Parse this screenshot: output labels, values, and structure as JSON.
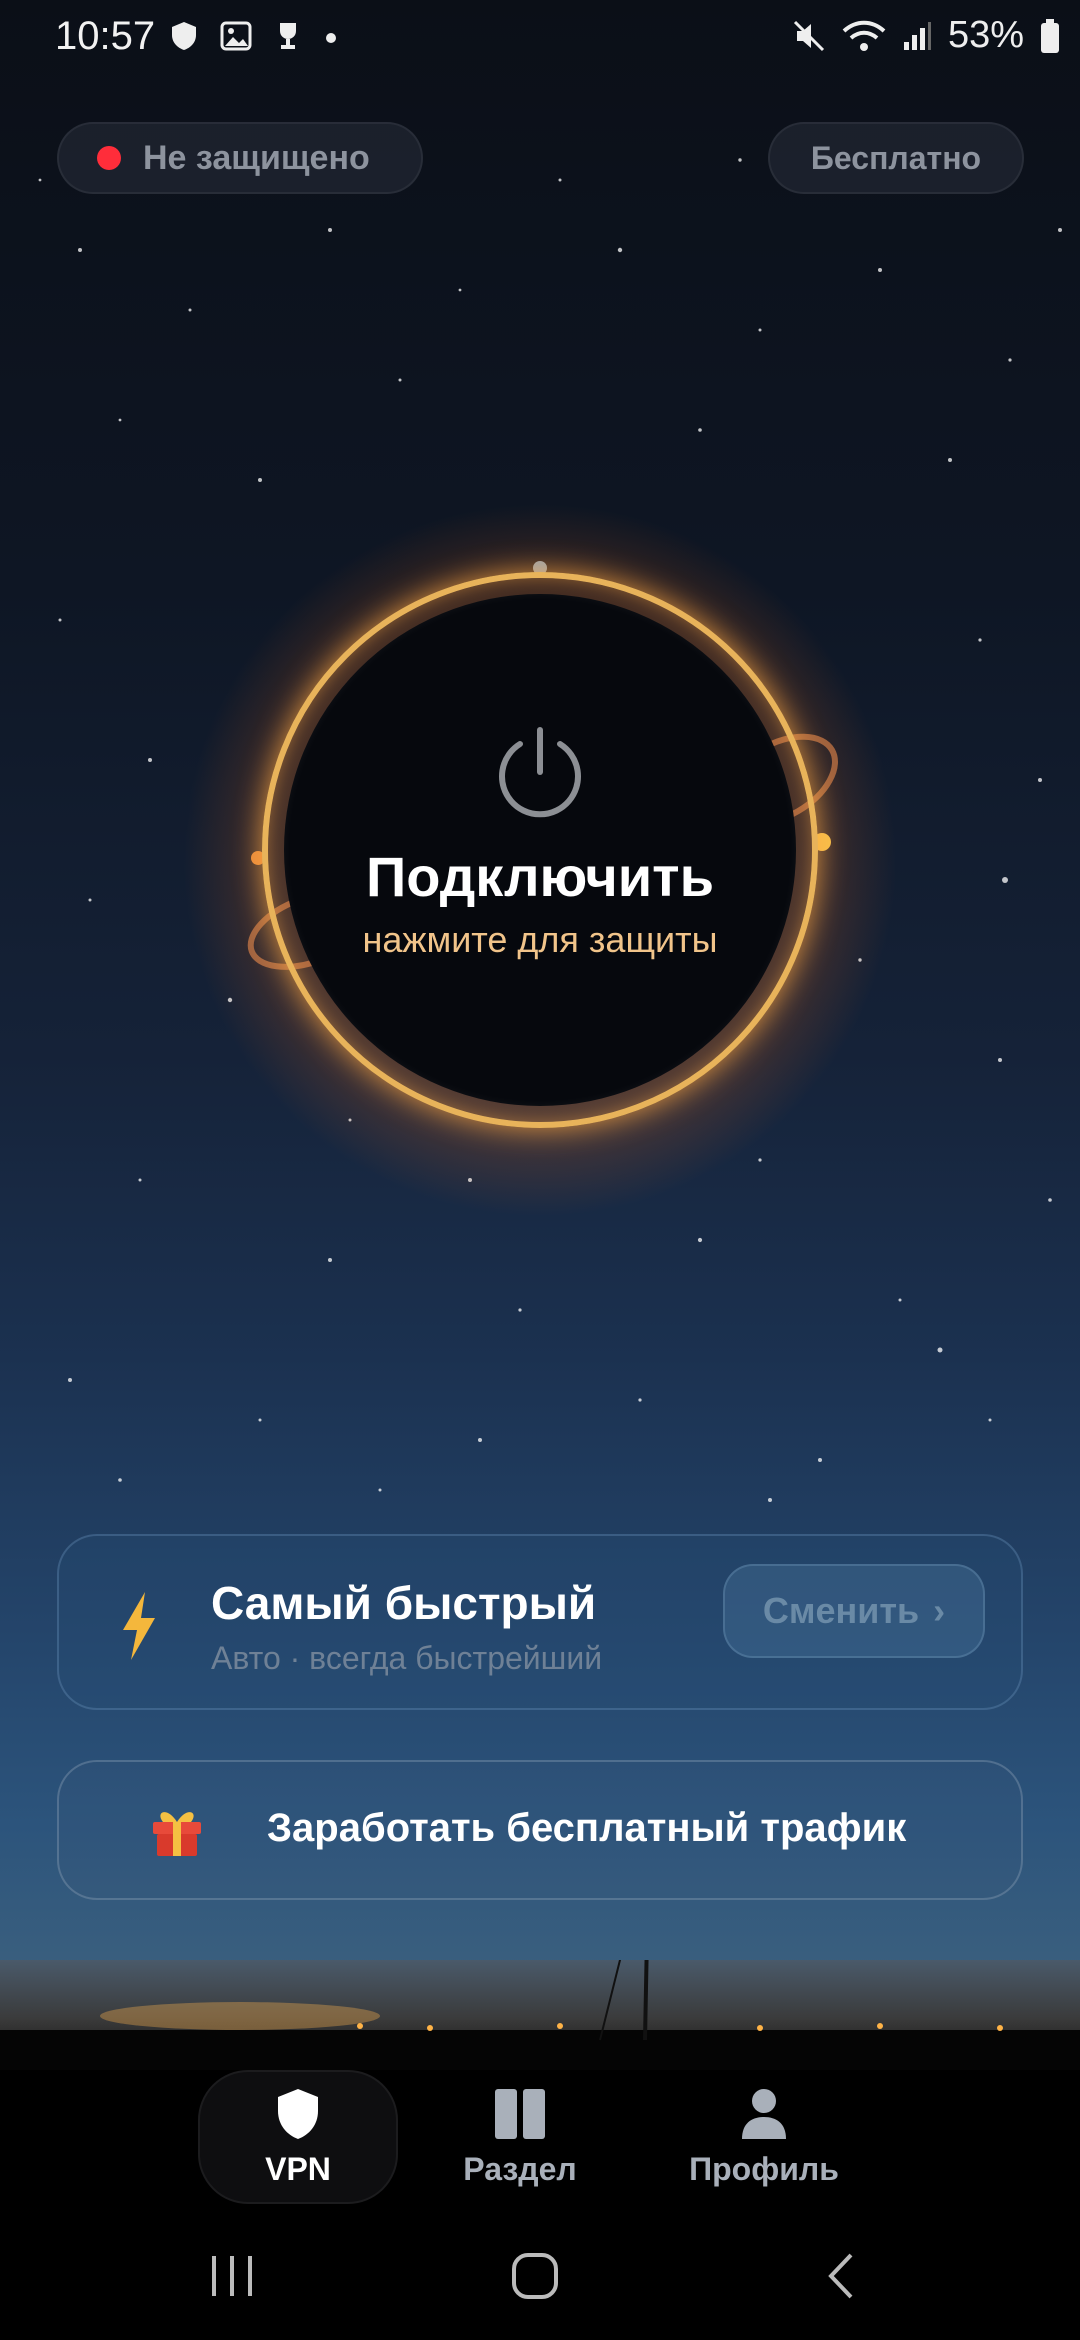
{
  "status_bar": {
    "time": "10:57",
    "battery": "53%",
    "left_icons": [
      "shield-icon",
      "image-icon",
      "trophy-icon",
      "dot-icon"
    ],
    "right_icons": [
      "mute-icon",
      "wifi-icon",
      "signal-icon",
      "battery-icon"
    ]
  },
  "header": {
    "connection_status": "Не защищено",
    "status_color": "#ff2d3a",
    "plan": "Бесплатно"
  },
  "connect": {
    "title": "Подключить",
    "subtitle": "нажмите для защиты",
    "accent": "#e8b35a"
  },
  "server": {
    "title": "Самый быстрый",
    "subtitle": "Авто · всегда быстрейший",
    "change_label": "Сменить",
    "change_chevron": "›"
  },
  "earn": {
    "label": "Заработать бесплатный трафик"
  },
  "tabs": [
    {
      "label": "VPN",
      "icon": "shield-icon",
      "active": true
    },
    {
      "label": "Раздел",
      "icon": "split-icon",
      "active": false
    },
    {
      "label": "Профиль",
      "icon": "profile-icon",
      "active": false
    }
  ],
  "system_nav": [
    "recents-icon",
    "home-icon",
    "back-icon"
  ]
}
